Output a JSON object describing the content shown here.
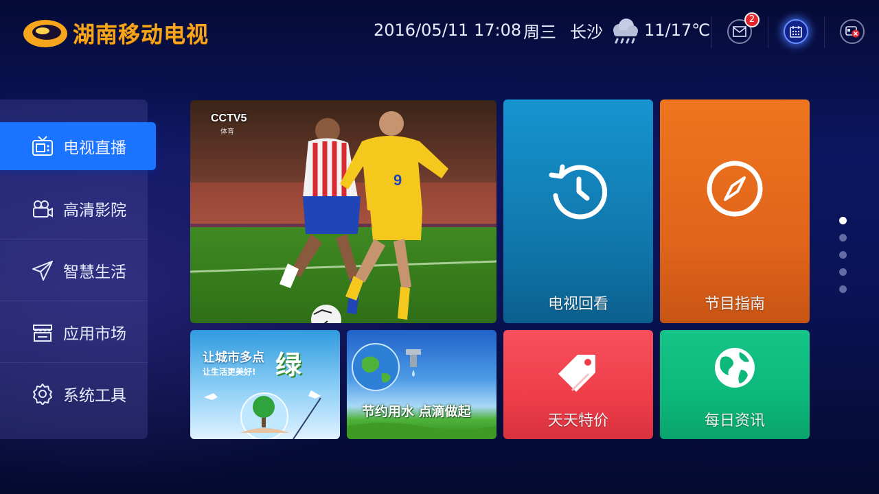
{
  "brand": {
    "name": "湖南移动电视",
    "color": "#f7a51d"
  },
  "status_bar": {
    "datetime": "2016/05/11 17:08",
    "weekday": "周三",
    "city": "长沙",
    "weather_icon": "rain-cloud-icon",
    "temperature": "11/17℃",
    "mail_badge": "2"
  },
  "sidebar": {
    "items": [
      {
        "label": "电视直播",
        "icon": "tv-icon",
        "active": true
      },
      {
        "label": "高清影院",
        "icon": "video-camera-icon"
      },
      {
        "label": "智慧生活",
        "icon": "paper-plane-icon"
      },
      {
        "label": "应用市场",
        "icon": "store-icon"
      },
      {
        "label": "系统工具",
        "icon": "gear-icon"
      }
    ],
    "accent": "#1a74ff"
  },
  "tiles": {
    "featured": {
      "channel_logo": "CCTV5",
      "channel_sub": "体育"
    },
    "replay": {
      "label": "电视回看",
      "icon": "history-clock-icon",
      "color": "#1688c4"
    },
    "guide": {
      "label": "节目指南",
      "icon": "compass-icon",
      "color": "#e96a1c"
    },
    "green_city": {
      "title": "让城市多点",
      "big_char": "绿",
      "subtitle": "让生活更美好!"
    },
    "save_water": {
      "title": "节约用水 点滴做起"
    },
    "deals": {
      "label": "天天特价",
      "icon": "price-tag-icon",
      "color": "#f2434f"
    },
    "news": {
      "label": "每日资讯",
      "icon": "globe-icon",
      "color": "#0dbd7e"
    }
  },
  "pager": {
    "count": 5,
    "active_index": 0
  }
}
